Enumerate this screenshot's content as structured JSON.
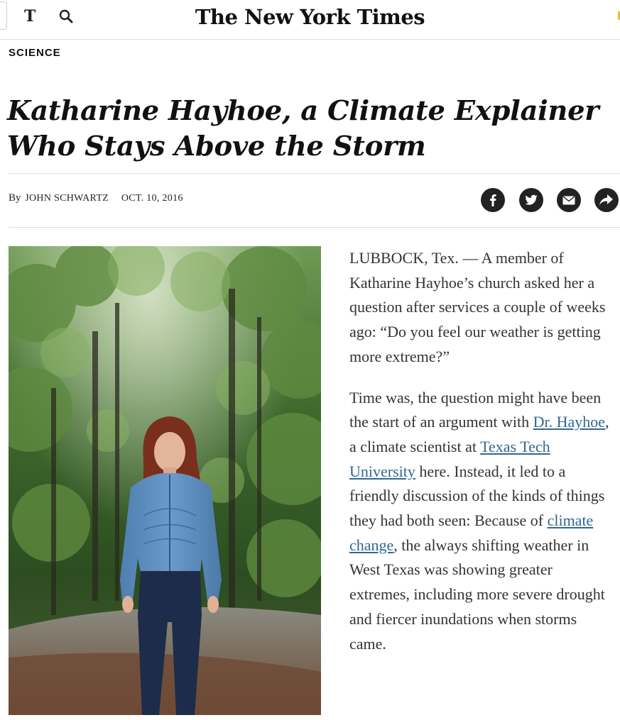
{
  "header": {
    "logo_glyph": "T",
    "logo_icon": "nyt-t-logo-icon",
    "search_icon": "search-icon",
    "masthead": "The New York Times"
  },
  "article": {
    "section": "SCIENCE",
    "headline": "Katharine Hayhoe, a Climate Explainer Who Stays Above the Storm",
    "byline_prefix": "By",
    "author": "JOHN SCHWARTZ",
    "date": "OCT. 10, 2016",
    "share_icons": [
      "facebook-icon",
      "twitter-icon",
      "email-icon",
      "share-icon"
    ],
    "paragraph1": "LUBBOCK, Tex. — A member of Katharine Hayhoe’s church asked her a question after services a couple of weeks ago: “Do you feel our weather is getting more extreme?”",
    "p2_part1": "Time was, the question might have been the start of an argument with ",
    "p2_link1": "Dr. Hayhoe",
    "p2_part2": ", a climate scientist at ",
    "p2_link2": "Texas Tech University",
    "p2_part3": " here. Instead, it led to a friendly discussion of the kinds of things they had both seen: Because of ",
    "p2_link3": "climate change",
    "p2_part4": ", the always shifting weather in West Texas was showing greater extremes, including more severe drought and fiercer inundations when storms came."
  },
  "colors": {
    "link": "#326891",
    "text": "#333333",
    "rule": "#dddddd"
  }
}
